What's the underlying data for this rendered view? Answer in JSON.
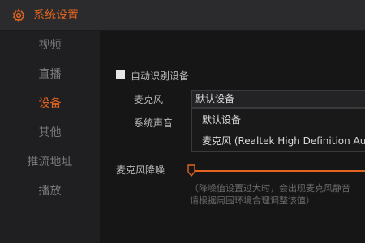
{
  "window": {
    "title": "系统设置",
    "title_icon": "gear-icon",
    "accent_color": "#e2641e"
  },
  "sidebar": {
    "items": [
      {
        "label": "视频",
        "active": false
      },
      {
        "label": "直播",
        "active": false
      },
      {
        "label": "设备",
        "active": true
      },
      {
        "label": "其他",
        "active": false
      },
      {
        "label": "推流地址",
        "active": false
      },
      {
        "label": "播放",
        "active": false
      }
    ]
  },
  "device": {
    "auto_detect_label": "自动识别设备",
    "auto_detect_checked": false,
    "mic_label": "麦克风",
    "mic_selected": "默认设备",
    "system_audio_label": "系统声音",
    "mic_options": [
      "默认设备",
      "麦克风 (Realtek High Definition Audio)"
    ],
    "noise_label": "麦克风降噪",
    "noise_level": 0,
    "hint_line1": "（降噪值设置过大时，会出现麦克风静音",
    "hint_line2": "请根据周围环境合理调整该值）"
  }
}
